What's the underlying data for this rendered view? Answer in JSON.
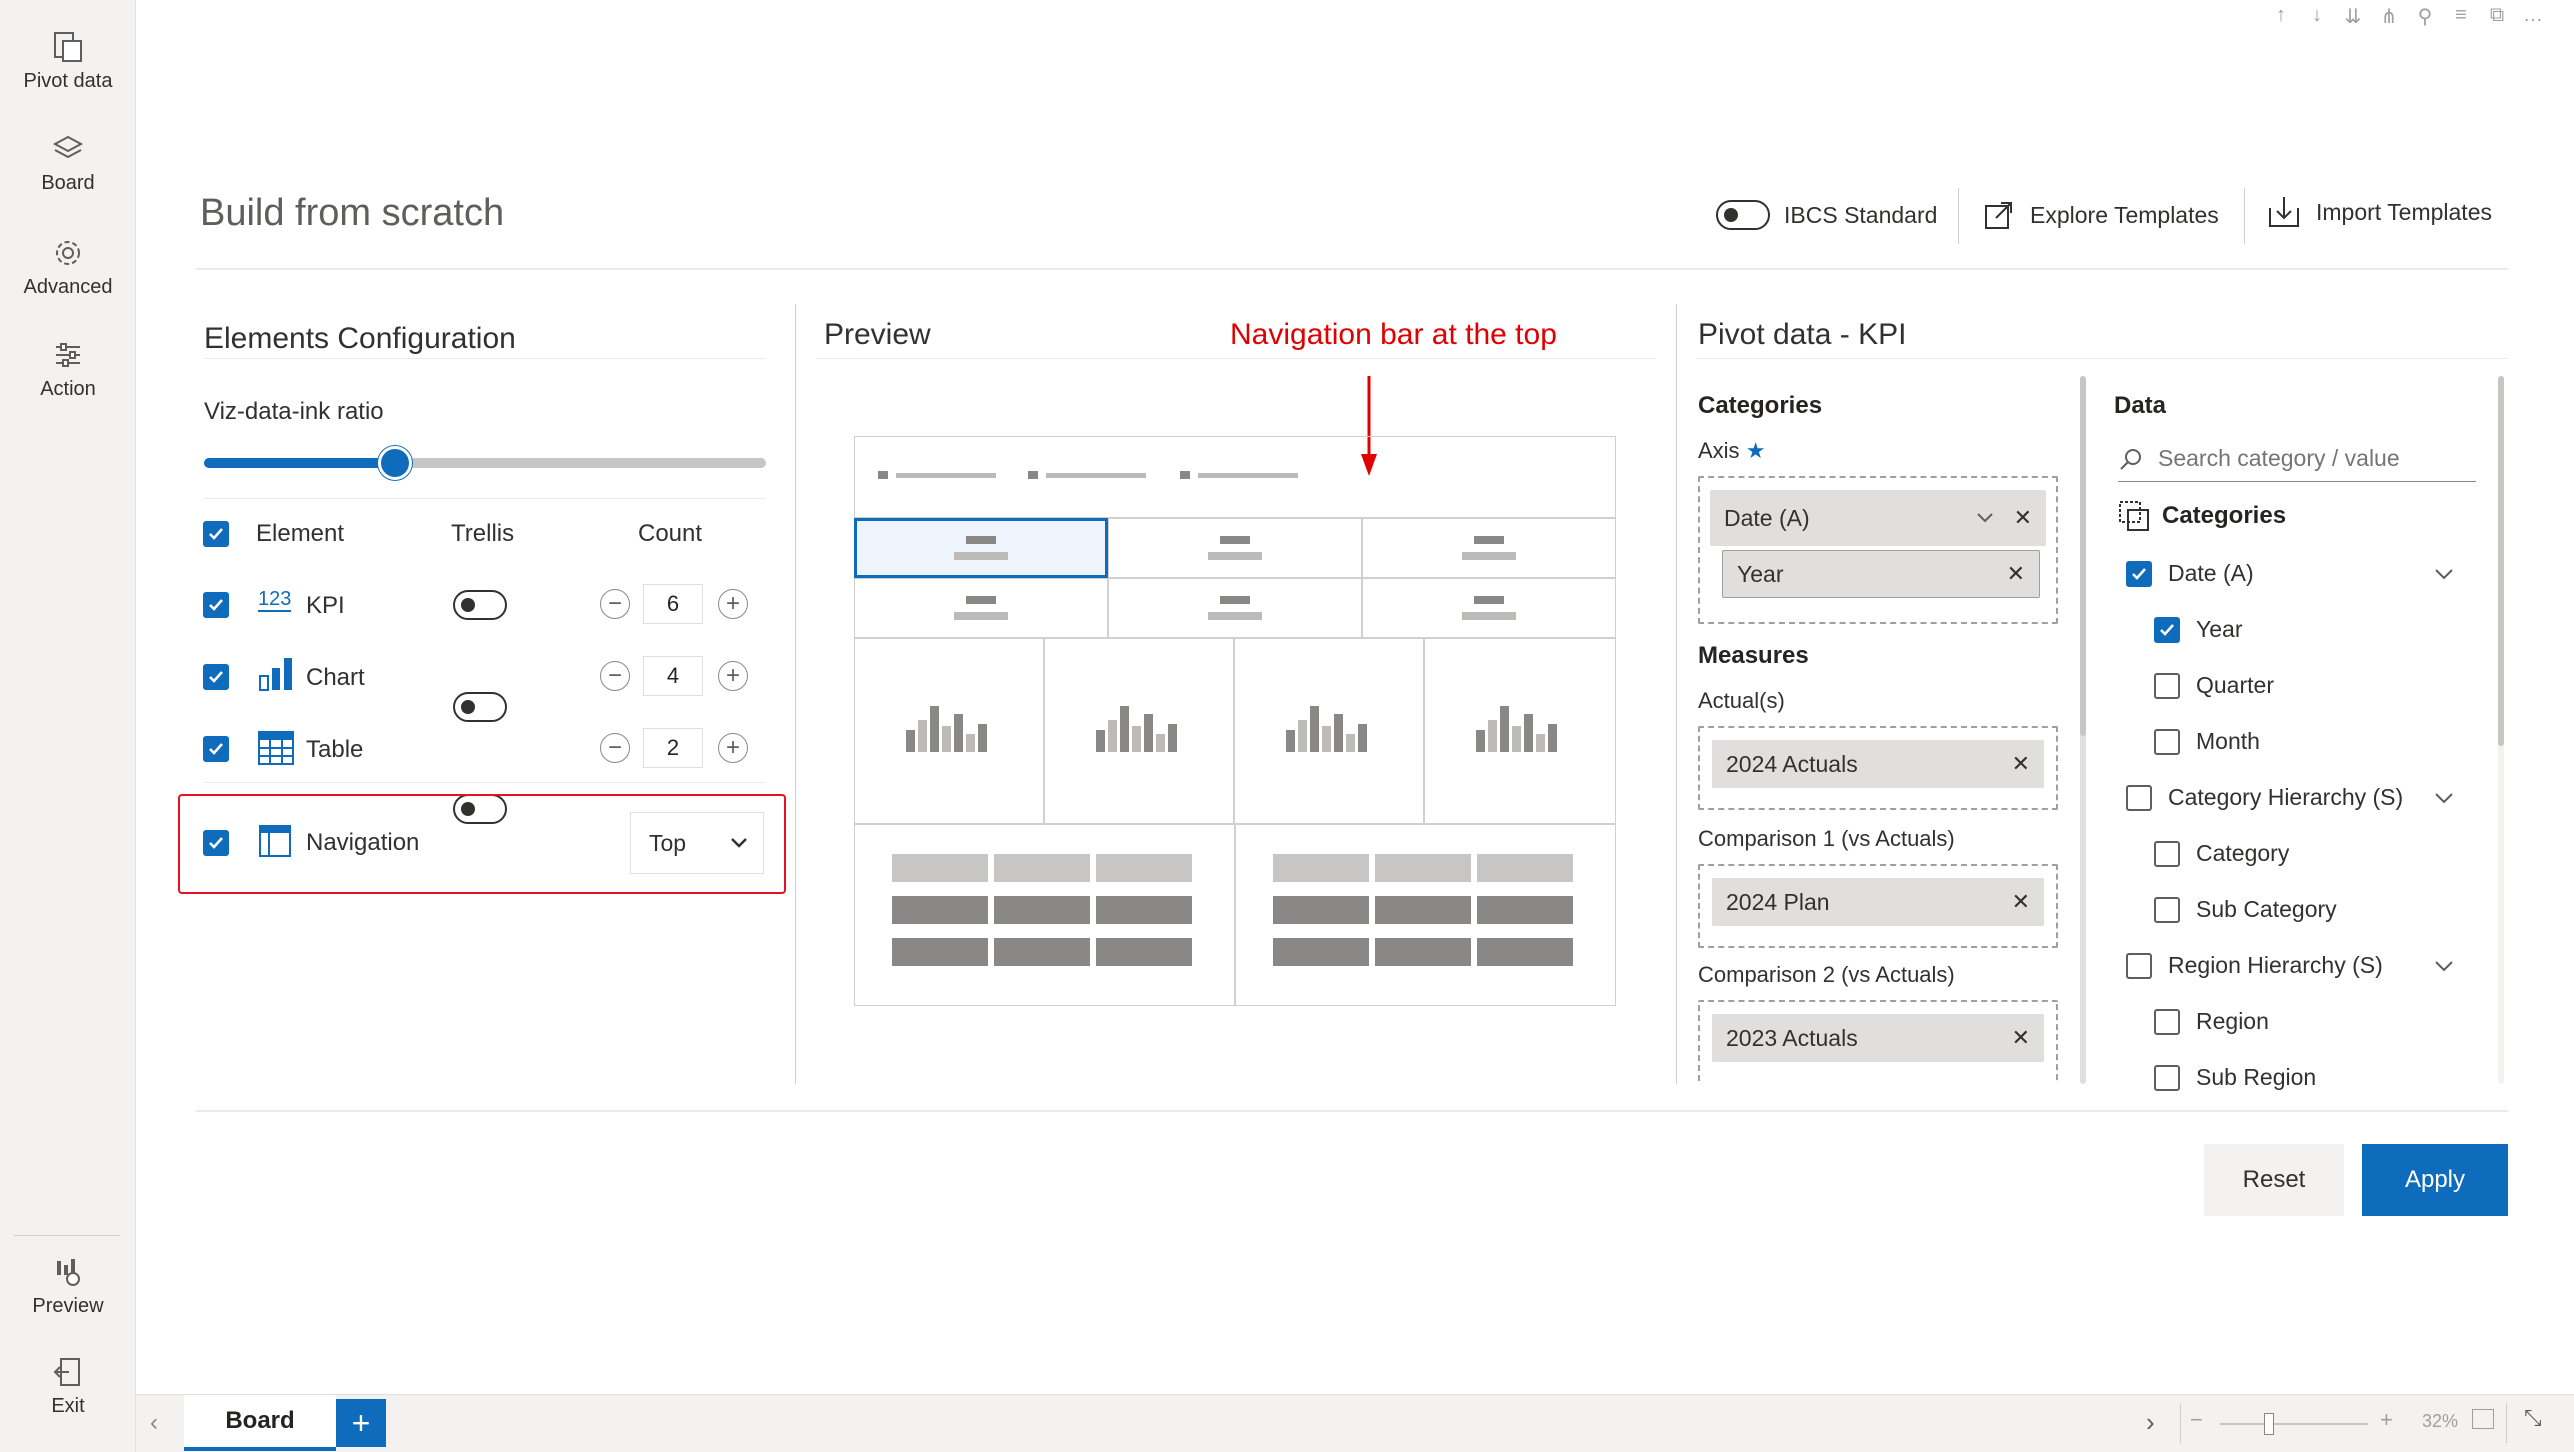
{
  "sidebar": {
    "items": [
      {
        "label": "Pivot data",
        "icon": "pivot-data-icon"
      },
      {
        "label": "Board",
        "icon": "board-layers-icon"
      },
      {
        "label": "Advanced",
        "icon": "gear-icon"
      },
      {
        "label": "Action",
        "icon": "sliders-icon"
      }
    ],
    "bottom": [
      {
        "label": "Preview",
        "icon": "preview-icon"
      },
      {
        "label": "Exit",
        "icon": "exit-icon"
      }
    ]
  },
  "header": {
    "title": "Build from scratch",
    "ibcs_label": "IBCS Standard",
    "explore_label": "Explore Templates",
    "import_label": "Import Templates"
  },
  "elements_config": {
    "title": "Elements Configuration",
    "slider_label": "Viz-data-ink ratio",
    "slider_value": 0.34,
    "col_element": "Element",
    "col_trellis": "Trellis",
    "col_count": "Count",
    "rows": [
      {
        "icon_text": "123",
        "label": "KPI",
        "count": "6"
      },
      {
        "icon_text": "",
        "label": "Chart",
        "count": "4"
      },
      {
        "icon_text": "",
        "label": "Table",
        "count": "2"
      }
    ],
    "navigation": {
      "label": "Navigation",
      "position": "Top"
    }
  },
  "preview": {
    "title": "Preview",
    "annotation": "Navigation bar at the top"
  },
  "pivot_panel": {
    "title": "Pivot data - KPI",
    "categories_label": "Categories",
    "axis_label": "Axis",
    "axis_chip": "Date (A)",
    "axis_sub_chip": "Year",
    "measures_label": "Measures",
    "actuals_label": "Actual(s)",
    "actuals_chip": "2024 Actuals",
    "comp1_label": "Comparison 1 (vs Actuals)",
    "comp1_chip": "2024 Plan",
    "comp2_label": "Comparison 2 (vs Actuals)",
    "comp2_chip": "2023 Actuals"
  },
  "data_panel": {
    "title": "Data",
    "search_placeholder": "Search category / value",
    "categories_label": "Categories",
    "items": [
      {
        "label": "Date (A)",
        "checked": true,
        "level": 0,
        "expandable": true
      },
      {
        "label": "Year",
        "checked": true,
        "level": 1,
        "expandable": false
      },
      {
        "label": "Quarter",
        "checked": false,
        "level": 1,
        "expandable": false
      },
      {
        "label": "Month",
        "checked": false,
        "level": 1,
        "expandable": false
      },
      {
        "label": "Category Hierarchy (S)",
        "checked": false,
        "level": 0,
        "expandable": true
      },
      {
        "label": "Category",
        "checked": false,
        "level": 1,
        "expandable": false
      },
      {
        "label": "Sub Category",
        "checked": false,
        "level": 1,
        "expandable": false
      },
      {
        "label": "Region Hierarchy (S)",
        "checked": false,
        "level": 0,
        "expandable": true
      },
      {
        "label": "Region",
        "checked": false,
        "level": 1,
        "expandable": false
      },
      {
        "label": "Sub Region",
        "checked": false,
        "level": 1,
        "expandable": false
      }
    ]
  },
  "footer": {
    "reset_label": "Reset",
    "apply_label": "Apply"
  },
  "tabbar": {
    "tab_label": "Board",
    "zoom": "32%"
  },
  "colors": {
    "accent": "#0f6cbd",
    "highlight_red": "#e81123",
    "annotation_red": "#e00000"
  }
}
